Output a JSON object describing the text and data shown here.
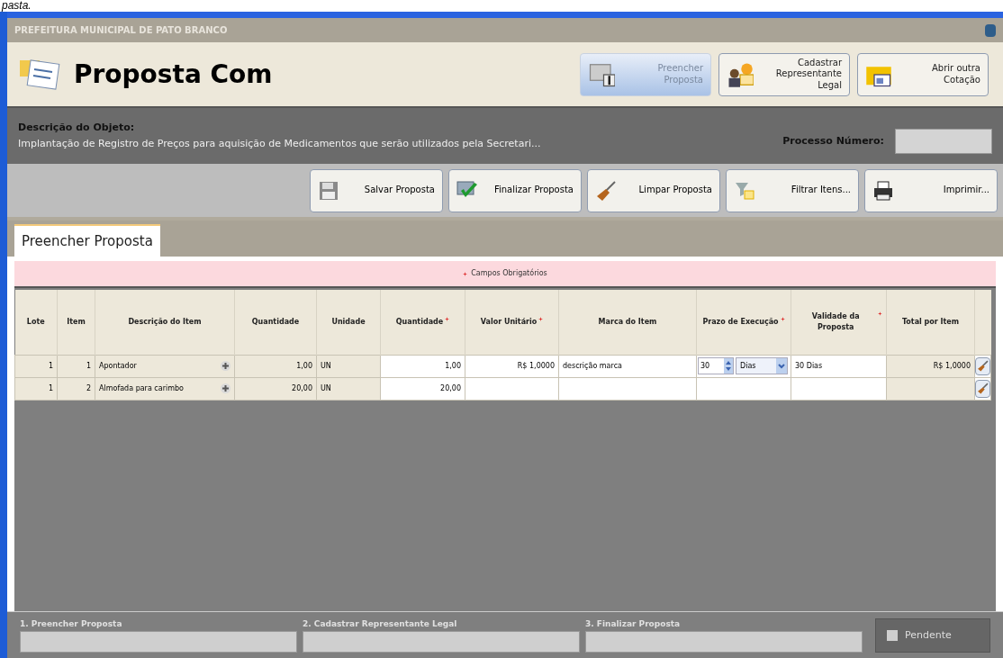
{
  "caption": "pasta.",
  "org_bar": {
    "title": "PREFEITURA MUNICIPAL DE PATO BRANCO"
  },
  "header": {
    "title": "Proposta Com",
    "buttons": [
      {
        "label": "Preencher Proposta",
        "selected": true
      },
      {
        "label": "Cadastrar Representante Legal",
        "selected": false
      },
      {
        "label": "Abrir outra Cotação",
        "selected": false
      }
    ]
  },
  "description": {
    "label": "Descrição do Objeto:",
    "text": "Implantação de Registro de Preços para aquisição de Medicamentos que serão utilizados pela Secretari...",
    "process_label": "Processo Número:"
  },
  "toolbar": [
    {
      "label": "Salvar Proposta"
    },
    {
      "label": "Finalizar Proposta"
    },
    {
      "label": "Limpar Proposta"
    },
    {
      "label": "Filtrar Itens..."
    },
    {
      "label": "Imprimir..."
    }
  ],
  "tabs": [
    {
      "label": "Preencher Proposta",
      "selected": true
    }
  ],
  "required_note": "Campos Obrigatórios",
  "table": {
    "columns": [
      {
        "label": "Lote",
        "required": false
      },
      {
        "label": "Item",
        "required": false
      },
      {
        "label": "Descrição do Item",
        "required": false
      },
      {
        "label": "Quantidade",
        "required": false
      },
      {
        "label": "Unidade",
        "required": false
      },
      {
        "label": "Quantidade",
        "required": true
      },
      {
        "label": "Valor Unitário",
        "required": true
      },
      {
        "label": "Marca do Item",
        "required": false
      },
      {
        "label": "Prazo de Execução",
        "required": true
      },
      {
        "label": "Validade da Proposta",
        "required": true
      },
      {
        "label": "Total por Item",
        "required": false
      }
    ],
    "rows": [
      {
        "lote": "1",
        "item": "1",
        "description": "Apontador",
        "quantity": "1,00",
        "unit": "UN",
        "quantity_offered": "1,00",
        "unit_price": "R$ 1,0000",
        "brand": "descrição marca",
        "term": {
          "value": "30",
          "unit": "Dias"
        },
        "validity": "30 Dias",
        "total": "R$ 1,0000"
      },
      {
        "lote": "1",
        "item": "2",
        "description": "Almofada para carimbo",
        "quantity": "20,00",
        "unit": "UN",
        "quantity_offered": "20,00"
      }
    ]
  },
  "steps": [
    {
      "label": "1. Preencher Proposta"
    },
    {
      "label": "2. Cadastrar Representante Legal"
    },
    {
      "label": "3. Finalizar Proposta"
    }
  ],
  "status_button": {
    "label": "Pendente"
  }
}
